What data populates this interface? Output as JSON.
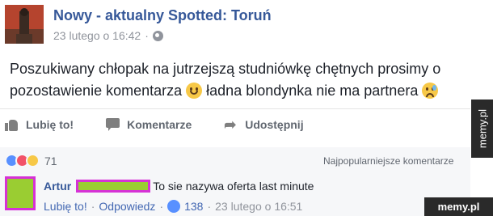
{
  "post": {
    "page_name": "Nowy - aktualny Spotted: Toruń",
    "timestamp": "23 lutego o 16:42",
    "separator": "·",
    "privacy_icon": "globe-icon",
    "text_part1": "Poszukiwany chłopak na jutrzejszą studniówkę chętnych prosimy o pozostawienie komentarza",
    "text_part2": "ładna blondynka nie ma partnera",
    "emoji1": "smile-emoji",
    "emoji2": "sad-sweat-emoji"
  },
  "actions": {
    "like_label": "Lubię to!",
    "comment_label": "Komentarze",
    "share_label": "Udostępnij"
  },
  "reactions": {
    "count": "71",
    "types": [
      "like",
      "love",
      "haha"
    ]
  },
  "sort_label": "Najpopularniejsze komentarze",
  "comment": {
    "author": "Artur",
    "text": "To sie nazywa oferta last minute",
    "like_link": "Lubię to!",
    "reply_link": "Odpowiedz",
    "like_count": "138",
    "timestamp": "23 lutego o 16:51",
    "dot": "·"
  },
  "watermarks": {
    "side": "memy.pl",
    "corner": "memy.pl"
  },
  "colors": {
    "link_blue": "#365899",
    "redact_fill": "#9acd32",
    "redact_border": "#d631d6"
  }
}
